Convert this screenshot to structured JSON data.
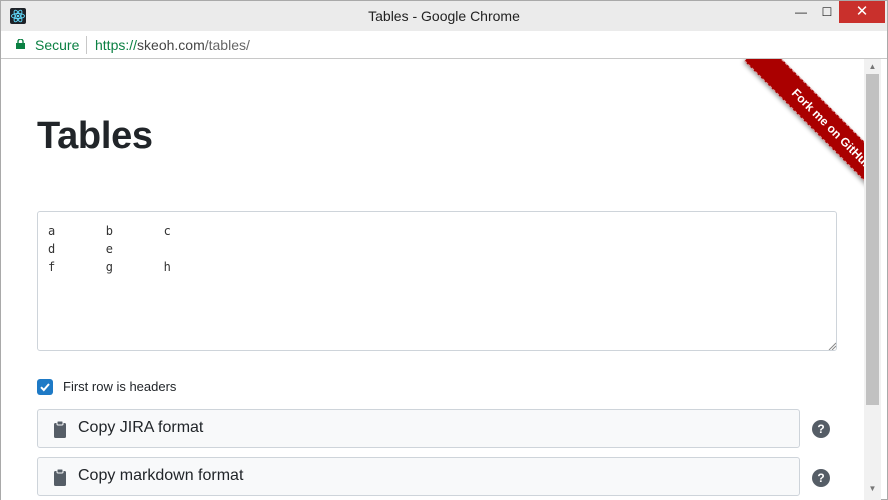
{
  "window": {
    "title": "Tables - Google Chrome",
    "minimize": "—",
    "maximize": "☐",
    "close": "✕"
  },
  "address": {
    "secure_label": "Secure",
    "url_scheme": "https://",
    "url_host": "skeoh.com",
    "url_path": "/tables/"
  },
  "page": {
    "title": "Tables",
    "ribbon": "Fork me on GitHub",
    "table_text": "a\tb\tc\nd\te\nf\tg\th",
    "checkbox_checked": true,
    "checkbox_label": "First row is headers",
    "buttons": [
      {
        "label": "Copy JIRA format",
        "help": "?"
      },
      {
        "label": "Copy markdown format",
        "help": "?"
      }
    ]
  },
  "colors": {
    "secure_green": "#0b8043",
    "ribbon_red": "#aa0000",
    "checkbox_blue": "#1e7ac6",
    "close_red": "#c9302c"
  },
  "icons": [
    "react-app-icon",
    "lock-icon",
    "clipboard-icon",
    "question-circle-icon",
    "checkmark-icon"
  ]
}
